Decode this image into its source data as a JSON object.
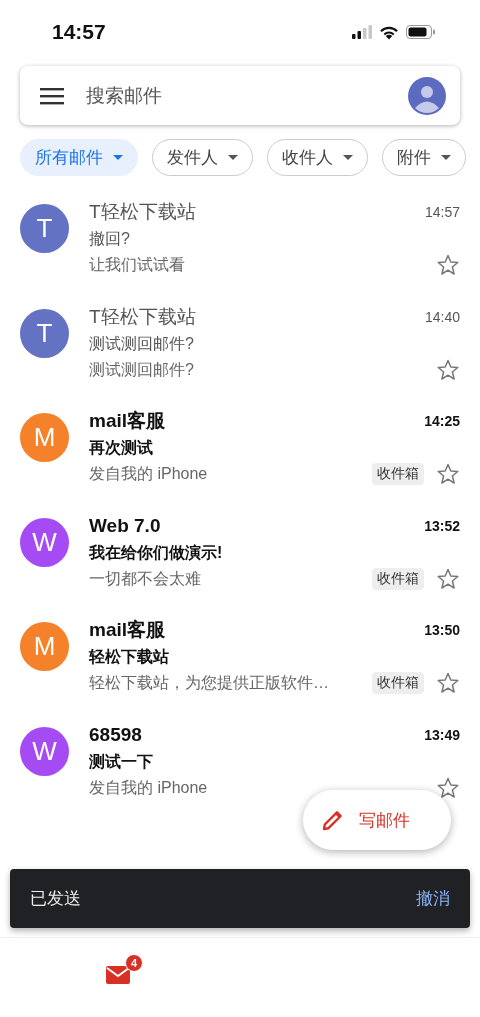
{
  "status_bar": {
    "time": "14:57"
  },
  "search": {
    "placeholder": "搜索邮件"
  },
  "filters": [
    {
      "label": "所有邮件",
      "selected": true
    },
    {
      "label": "发件人",
      "selected": false
    },
    {
      "label": "收件人",
      "selected": false
    },
    {
      "label": "附件",
      "selected": false
    }
  ],
  "emails": [
    {
      "initial": "T",
      "color": "#5c6bc0",
      "sender": "T轻松下载站",
      "time": "14:57",
      "subject": "撤回?",
      "snippet": "让我们试试看",
      "unread": false,
      "starred": false
    },
    {
      "initial": "T",
      "color": "#5c6bc0",
      "sender": "T轻松下载站",
      "time": "14:40",
      "subject": "测试测回邮件?",
      "snippet": "测试测回邮件?",
      "unread": false,
      "starred": false
    },
    {
      "initial": "M",
      "color": "#f57c1f",
      "sender": "mail客服",
      "time": "14:25",
      "subject": "再次测试",
      "snippet": "发自我的 iPhone",
      "label": "收件箱",
      "unread": true,
      "starred": false
    },
    {
      "initial": "W",
      "color": "#a142f4",
      "sender": "Web 7.0",
      "time": "13:52",
      "subject": "我在给你们做演示!",
      "snippet": "一切都不会太难",
      "label": "收件箱",
      "unread": true,
      "starred": false
    },
    {
      "initial": "M",
      "color": "#f57c1f",
      "sender": "mail客服",
      "time": "13:50",
      "subject": "轻松下载站",
      "snippet": "轻松下载站，为您提供正版软件…",
      "label": "收件箱",
      "unread": true,
      "starred": false
    },
    {
      "initial": "W",
      "color": "#a142f4",
      "sender": "68598",
      "time": "13:49",
      "subject": "测试一下",
      "snippet": "发自我的 iPhone",
      "unread": true,
      "starred": false
    }
  ],
  "compose_button": {
    "label": "写邮件"
  },
  "snackbar": {
    "message": "已发送",
    "action": "撤消"
  },
  "bottom_nav": {
    "mail_badge": "4"
  }
}
